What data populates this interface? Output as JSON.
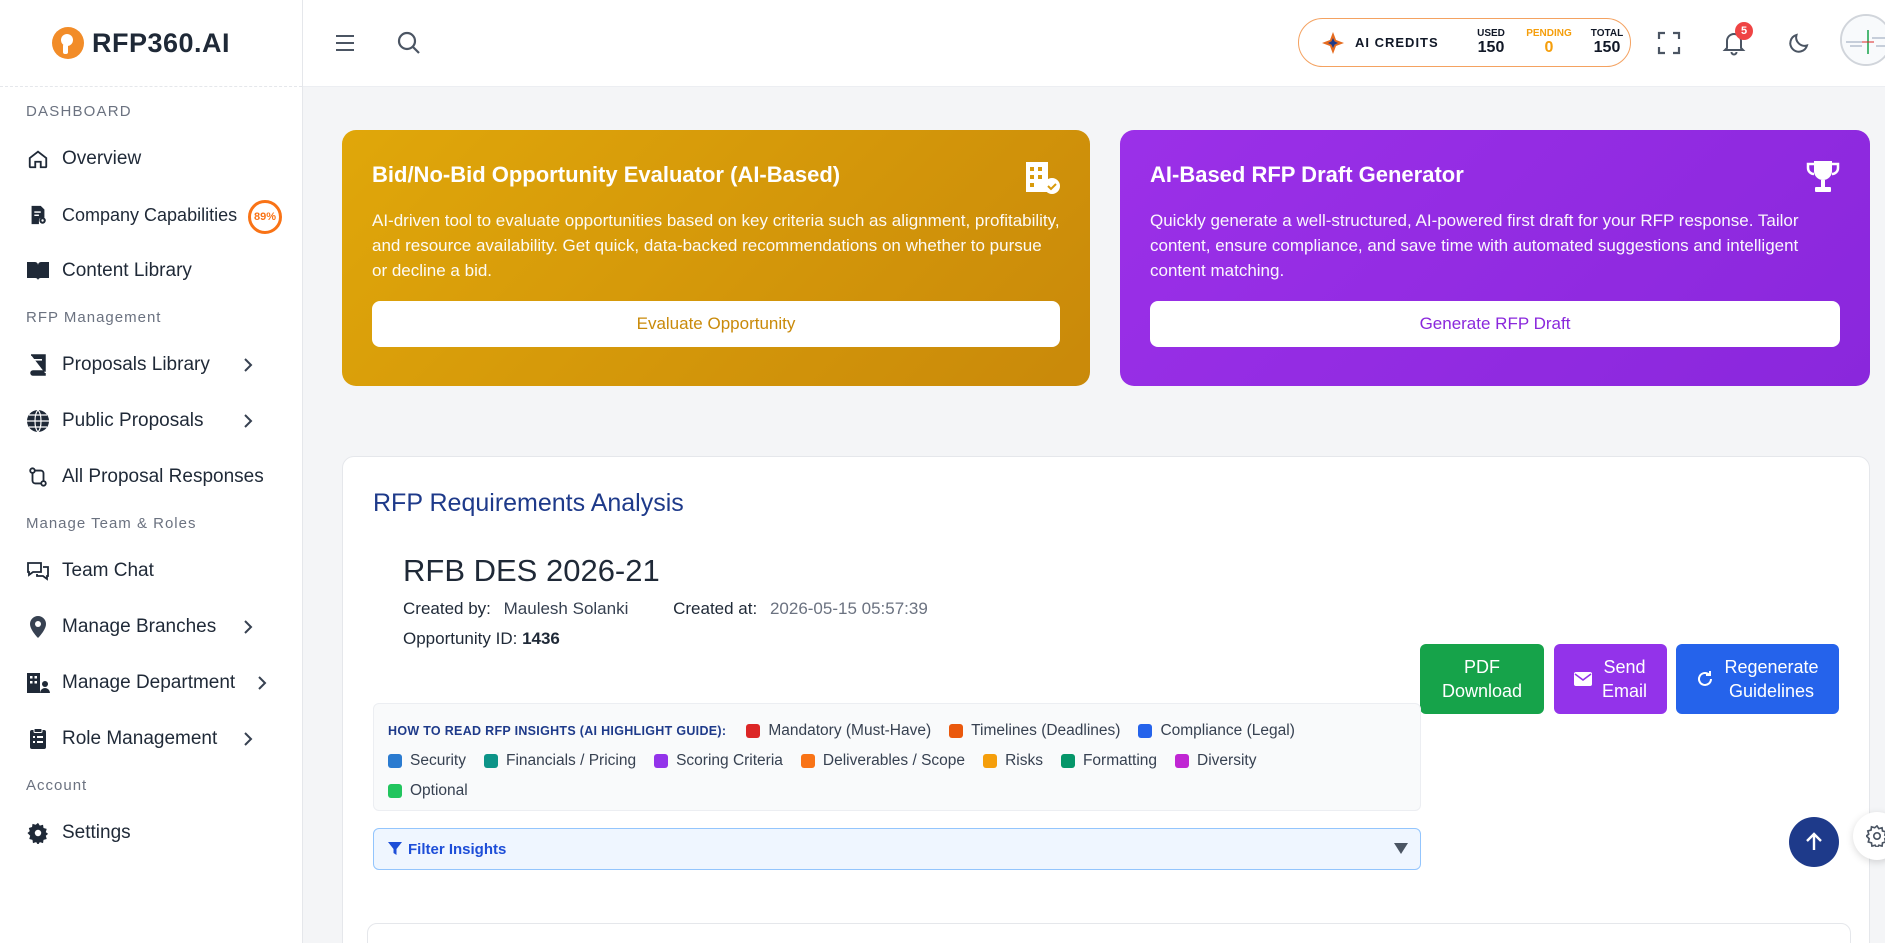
{
  "brand": {
    "name": "RFP360.AI"
  },
  "sidebar": {
    "sections": {
      "dashboard": "DASHBOARD",
      "rfp_management": "RFP Management",
      "team": "Manage Team & Roles",
      "account": "Account"
    },
    "items": {
      "overview": "Overview",
      "company_capabilities": "Company Capabilities",
      "company_capabilities_badge": "89%",
      "content_library": "Content Library",
      "proposals_library": "Proposals Library",
      "public_proposals": "Public Proposals",
      "all_proposal_responses": "All Proposal Responses",
      "team_chat": "Team Chat",
      "manage_branches": "Manage Branches",
      "manage_department": "Manage Department",
      "role_management": "Role Management",
      "settings": "Settings"
    }
  },
  "topbar": {
    "credits": {
      "label": "AI CREDITS",
      "used_label": "USED",
      "used": "150",
      "pending_label": "PENDING",
      "pending": "0",
      "total_label": "TOTAL",
      "total": "150"
    },
    "notifications_count": "5"
  },
  "cards": {
    "bid": {
      "title": "Bid/No-Bid Opportunity Evaluator (AI-Based)",
      "description": "AI-driven tool to evaluate opportunities based on key criteria such as alignment, profitability, and resource availability. Get quick, data-backed recommendations on whether to pursue or decline a bid.",
      "button": "Evaluate Opportunity"
    },
    "draft": {
      "title": "AI-Based RFP Draft Generator",
      "description": "Quickly generate a well-structured, AI-powered first draft for your RFP response. Tailor content, ensure compliance, and save time with automated suggestions and intelligent content matching.",
      "button": "Generate RFP Draft"
    }
  },
  "analysis": {
    "title": "RFP Requirements Analysis",
    "rfb_name": "RFB DES 2026-21",
    "created_by_label": "Created by:",
    "created_by": "Maulesh Solanki",
    "created_at_label": "Created at:",
    "created_at": "2026-05-15 05:57:39",
    "opportunity_label": "Opportunity ID:",
    "opportunity_id": "1436",
    "actions": {
      "pdf_line1": "PDF",
      "pdf_line2": "Download",
      "email_line1": "Send",
      "email_line2": "Email",
      "regen_line1": "Regenerate",
      "regen_line2": "Guidelines"
    },
    "guide": {
      "heading": "HOW TO READ RFP INSIGHTS (AI HIGHLIGHT GUIDE):",
      "items": [
        {
          "label": "Mandatory (Must-Have)",
          "color": "#dc2626"
        },
        {
          "label": "Timelines (Deadlines)",
          "color": "#ea580c"
        },
        {
          "label": "Compliance (Legal)",
          "color": "#2563eb"
        },
        {
          "label": "Security",
          "color": "#2b7bd0"
        },
        {
          "label": "Financials / Pricing",
          "color": "#0d9488"
        },
        {
          "label": "Scoring Criteria",
          "color": "#9333ea"
        },
        {
          "label": "Deliverables / Scope",
          "color": "#f97316"
        },
        {
          "label": "Risks",
          "color": "#f59e0b"
        },
        {
          "label": "Formatting",
          "color": "#059669"
        },
        {
          "label": "Diversity",
          "color": "#c026d3"
        },
        {
          "label": "Optional",
          "color": "#22c55e"
        }
      ]
    },
    "filter_label": "Filter Insights"
  }
}
